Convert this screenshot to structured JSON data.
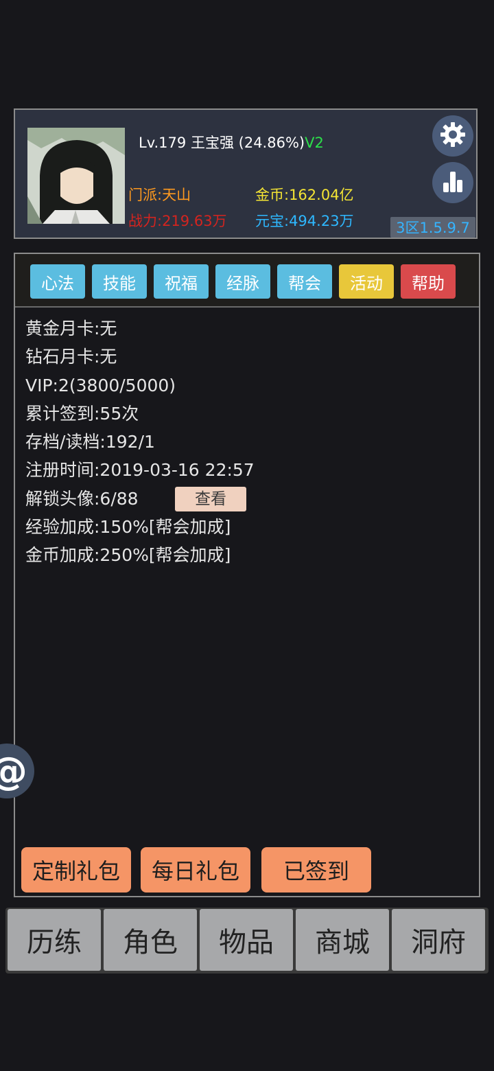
{
  "player": {
    "level_text": "Lv.179",
    "name": "王宝强",
    "exp_percent": "(24.86%)",
    "vip_tag": "V2",
    "sect": "门派:天山",
    "coins": "金币:162.04亿",
    "power": "战力:219.63万",
    "ingots": "元宝:494.23万",
    "server_version": "3区1.5.9.7"
  },
  "header_icons": {
    "settings": "gear-icon",
    "stats": "bar-chart-icon"
  },
  "tabs": [
    {
      "label": "心法",
      "color": "#5bbde0"
    },
    {
      "label": "技能",
      "color": "#5bbde0"
    },
    {
      "label": "祝福",
      "color": "#5bbde0"
    },
    {
      "label": "经脉",
      "color": "#5bbde0"
    },
    {
      "label": "帮会",
      "color": "#5bbde0"
    },
    {
      "label": "活动",
      "color": "#e8c73a"
    },
    {
      "label": "帮助",
      "color": "#d94a4c"
    }
  ],
  "info": {
    "gold_card": "黄金月卡:无",
    "diamond_card": "钻石月卡:无",
    "vip": "VIP:2(3800/5000)",
    "checkin_total": "累计签到:55次",
    "save_load": "存档/读档:192/1",
    "register_time": "注册时间:2019-03-16 22:57",
    "avatars_unlocked": "解锁头像:6/88",
    "view_button": "查看",
    "exp_bonus": "经验加成:150%[帮会加成]",
    "coin_bonus": "金币加成:250%[帮会加成]"
  },
  "actions": {
    "custom_gift": "定制礼包",
    "daily_gift": "每日礼包",
    "signed_in": "已签到"
  },
  "float_button": {
    "symbol": "@"
  },
  "bottom_nav": [
    {
      "label": "历练"
    },
    {
      "label": "角色"
    },
    {
      "label": "物品"
    },
    {
      "label": "商城"
    },
    {
      "label": "洞府"
    }
  ],
  "colors": {
    "background": "#17171b",
    "header_bg": "#2d3240",
    "tab_blue": "#5bbde0",
    "tab_yellow": "#e8c73a",
    "tab_red": "#d94a4c",
    "action_orange": "#f59566",
    "nav_gray": "#a7a8aa",
    "sect_orange": "#ff9a1f",
    "coin_yellow": "#f5e534",
    "power_red": "#d4241f",
    "ingot_blue": "#2eb8ff",
    "vip_green": "#2ce04a"
  }
}
